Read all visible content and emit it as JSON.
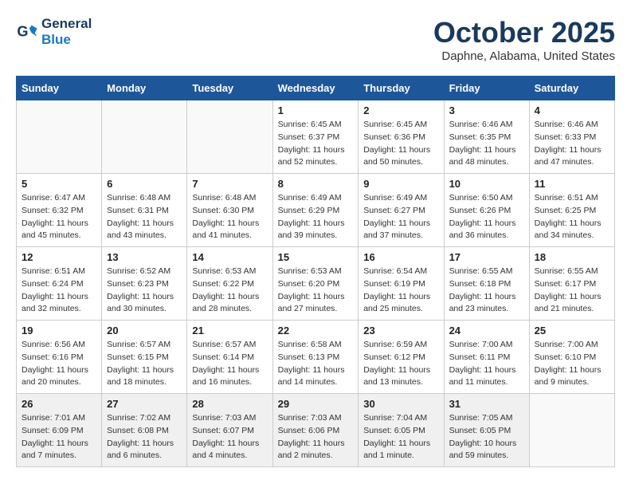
{
  "logo": {
    "line1": "General",
    "line2": "Blue"
  },
  "title": "October 2025",
  "location": "Daphne, Alabama, United States",
  "headers": [
    "Sunday",
    "Monday",
    "Tuesday",
    "Wednesday",
    "Thursday",
    "Friday",
    "Saturday"
  ],
  "weeks": [
    [
      {
        "day": "",
        "info": ""
      },
      {
        "day": "",
        "info": ""
      },
      {
        "day": "",
        "info": ""
      },
      {
        "day": "1",
        "info": "Sunrise: 6:45 AM\nSunset: 6:37 PM\nDaylight: 11 hours\nand 52 minutes."
      },
      {
        "day": "2",
        "info": "Sunrise: 6:45 AM\nSunset: 6:36 PM\nDaylight: 11 hours\nand 50 minutes."
      },
      {
        "day": "3",
        "info": "Sunrise: 6:46 AM\nSunset: 6:35 PM\nDaylight: 11 hours\nand 48 minutes."
      },
      {
        "day": "4",
        "info": "Sunrise: 6:46 AM\nSunset: 6:33 PM\nDaylight: 11 hours\nand 47 minutes."
      }
    ],
    [
      {
        "day": "5",
        "info": "Sunrise: 6:47 AM\nSunset: 6:32 PM\nDaylight: 11 hours\nand 45 minutes."
      },
      {
        "day": "6",
        "info": "Sunrise: 6:48 AM\nSunset: 6:31 PM\nDaylight: 11 hours\nand 43 minutes."
      },
      {
        "day": "7",
        "info": "Sunrise: 6:48 AM\nSunset: 6:30 PM\nDaylight: 11 hours\nand 41 minutes."
      },
      {
        "day": "8",
        "info": "Sunrise: 6:49 AM\nSunset: 6:29 PM\nDaylight: 11 hours\nand 39 minutes."
      },
      {
        "day": "9",
        "info": "Sunrise: 6:49 AM\nSunset: 6:27 PM\nDaylight: 11 hours\nand 37 minutes."
      },
      {
        "day": "10",
        "info": "Sunrise: 6:50 AM\nSunset: 6:26 PM\nDaylight: 11 hours\nand 36 minutes."
      },
      {
        "day": "11",
        "info": "Sunrise: 6:51 AM\nSunset: 6:25 PM\nDaylight: 11 hours\nand 34 minutes."
      }
    ],
    [
      {
        "day": "12",
        "info": "Sunrise: 6:51 AM\nSunset: 6:24 PM\nDaylight: 11 hours\nand 32 minutes."
      },
      {
        "day": "13",
        "info": "Sunrise: 6:52 AM\nSunset: 6:23 PM\nDaylight: 11 hours\nand 30 minutes."
      },
      {
        "day": "14",
        "info": "Sunrise: 6:53 AM\nSunset: 6:22 PM\nDaylight: 11 hours\nand 28 minutes."
      },
      {
        "day": "15",
        "info": "Sunrise: 6:53 AM\nSunset: 6:20 PM\nDaylight: 11 hours\nand 27 minutes."
      },
      {
        "day": "16",
        "info": "Sunrise: 6:54 AM\nSunset: 6:19 PM\nDaylight: 11 hours\nand 25 minutes."
      },
      {
        "day": "17",
        "info": "Sunrise: 6:55 AM\nSunset: 6:18 PM\nDaylight: 11 hours\nand 23 minutes."
      },
      {
        "day": "18",
        "info": "Sunrise: 6:55 AM\nSunset: 6:17 PM\nDaylight: 11 hours\nand 21 minutes."
      }
    ],
    [
      {
        "day": "19",
        "info": "Sunrise: 6:56 AM\nSunset: 6:16 PM\nDaylight: 11 hours\nand 20 minutes."
      },
      {
        "day": "20",
        "info": "Sunrise: 6:57 AM\nSunset: 6:15 PM\nDaylight: 11 hours\nand 18 minutes."
      },
      {
        "day": "21",
        "info": "Sunrise: 6:57 AM\nSunset: 6:14 PM\nDaylight: 11 hours\nand 16 minutes."
      },
      {
        "day": "22",
        "info": "Sunrise: 6:58 AM\nSunset: 6:13 PM\nDaylight: 11 hours\nand 14 minutes."
      },
      {
        "day": "23",
        "info": "Sunrise: 6:59 AM\nSunset: 6:12 PM\nDaylight: 11 hours\nand 13 minutes."
      },
      {
        "day": "24",
        "info": "Sunrise: 7:00 AM\nSunset: 6:11 PM\nDaylight: 11 hours\nand 11 minutes."
      },
      {
        "day": "25",
        "info": "Sunrise: 7:00 AM\nSunset: 6:10 PM\nDaylight: 11 hours\nand 9 minutes."
      }
    ],
    [
      {
        "day": "26",
        "info": "Sunrise: 7:01 AM\nSunset: 6:09 PM\nDaylight: 11 hours\nand 7 minutes."
      },
      {
        "day": "27",
        "info": "Sunrise: 7:02 AM\nSunset: 6:08 PM\nDaylight: 11 hours\nand 6 minutes."
      },
      {
        "day": "28",
        "info": "Sunrise: 7:03 AM\nSunset: 6:07 PM\nDaylight: 11 hours\nand 4 minutes."
      },
      {
        "day": "29",
        "info": "Sunrise: 7:03 AM\nSunset: 6:06 PM\nDaylight: 11 hours\nand 2 minutes."
      },
      {
        "day": "30",
        "info": "Sunrise: 7:04 AM\nSunset: 6:05 PM\nDaylight: 11 hours\nand 1 minute."
      },
      {
        "day": "31",
        "info": "Sunrise: 7:05 AM\nSunset: 6:05 PM\nDaylight: 10 hours\nand 59 minutes."
      },
      {
        "day": "",
        "info": ""
      }
    ]
  ]
}
